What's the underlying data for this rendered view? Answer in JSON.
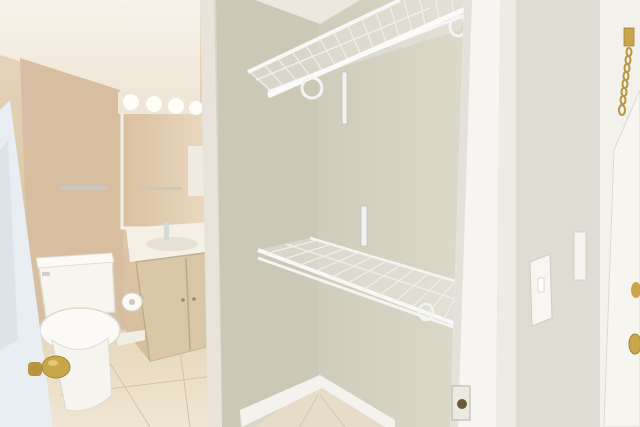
{
  "scene": {
    "colors": {
      "closet_wall": "#d6d3c3",
      "closet_wall_shadow": "#c4c1b0",
      "bathroom_wall": "#d8c3a8",
      "tile_floor": "#e9dcc4",
      "trim_white": "#f3f1ea",
      "shelf_wire": "#f6f6f4",
      "cabinet": "#d9c7a8",
      "brass": "#c9a64a",
      "ceiling": "#f4efe7"
    },
    "icons": [
      "door-knob-icon",
      "door-chain-icon",
      "light-switch-icon",
      "toilet-paper-icon"
    ]
  }
}
